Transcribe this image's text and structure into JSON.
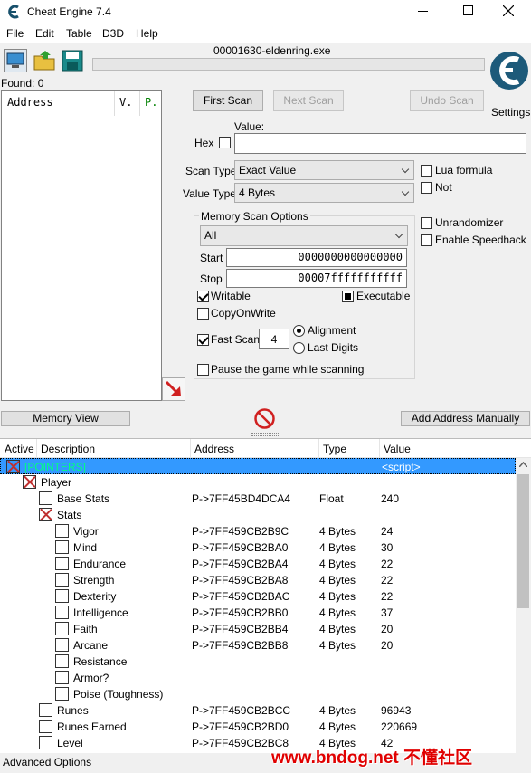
{
  "window": {
    "title": "Cheat Engine 7.4",
    "process": "00001630-eldenring.exe",
    "found": "Found: 0"
  },
  "menu": [
    "File",
    "Edit",
    "Table",
    "D3D",
    "Help"
  ],
  "results_headers": [
    "Address",
    "V.",
    "P."
  ],
  "scan": {
    "first_scan": "First Scan",
    "next_scan": "Next Scan",
    "undo_scan": "Undo Scan",
    "value_label": "Value:",
    "hex_label": "Hex",
    "scan_type_label": "Scan Type",
    "scan_type": "Exact Value",
    "value_type_label": "Value Type",
    "value_type": "4 Bytes",
    "lua_formula": "Lua formula",
    "not": "Not",
    "memory_options_title": "Memory Scan Options",
    "region": "All",
    "start_label": "Start",
    "start_value": "0000000000000000",
    "stop_label": "Stop",
    "stop_value": "00007fffffffffff",
    "writable": "Writable",
    "executable": "Executable",
    "copy_on_write": "CopyOnWrite",
    "fast_scan": "Fast Scan",
    "fast_scan_value": "4",
    "alignment": "Alignment",
    "last_digits": "Last Digits",
    "pause_game": "Pause the game while scanning",
    "unrandomizer": "Unrandomizer",
    "enable_speedhack": "Enable Speedhack",
    "settings": "Settings"
  },
  "bottom": {
    "memory_view": "Memory View",
    "add_address": "Add Address Manually",
    "advanced_options": "Advanced Options"
  },
  "table_headers": [
    "Active",
    "Description",
    "Address",
    "Type",
    "Value"
  ],
  "rows": [
    {
      "indent": 0,
      "box": "x",
      "desc": "[POINTERS]",
      "addr": "",
      "type": "",
      "value": "<script>",
      "selected": true
    },
    {
      "indent": 1,
      "box": "x",
      "desc": "Player",
      "addr": "",
      "type": "",
      "value": ""
    },
    {
      "indent": 2,
      "box": "empty",
      "desc": "Base Stats",
      "addr": "P->7FF45BD4DCA4",
      "type": "Float",
      "value": "240"
    },
    {
      "indent": 2,
      "box": "x",
      "desc": "Stats",
      "addr": "",
      "type": "",
      "value": ""
    },
    {
      "indent": 3,
      "box": "empty",
      "desc": "Vigor",
      "addr": "P->7FF459CB2B9C",
      "type": "4 Bytes",
      "value": "24"
    },
    {
      "indent": 3,
      "box": "empty",
      "desc": "Mind",
      "addr": "P->7FF459CB2BA0",
      "type": "4 Bytes",
      "value": "30"
    },
    {
      "indent": 3,
      "box": "empty",
      "desc": "Endurance",
      "addr": "P->7FF459CB2BA4",
      "type": "4 Bytes",
      "value": "22"
    },
    {
      "indent": 3,
      "box": "empty",
      "desc": "Strength",
      "addr": "P->7FF459CB2BA8",
      "type": "4 Bytes",
      "value": "22"
    },
    {
      "indent": 3,
      "box": "empty",
      "desc": "Dexterity",
      "addr": "P->7FF459CB2BAC",
      "type": "4 Bytes",
      "value": "22"
    },
    {
      "indent": 3,
      "box": "empty",
      "desc": "Intelligence",
      "addr": "P->7FF459CB2BB0",
      "type": "4 Bytes",
      "value": "37"
    },
    {
      "indent": 3,
      "box": "empty",
      "desc": "Faith",
      "addr": "P->7FF459CB2BB4",
      "type": "4 Bytes",
      "value": "20"
    },
    {
      "indent": 3,
      "box": "empty",
      "desc": "Arcane",
      "addr": "P->7FF459CB2BB8",
      "type": "4 Bytes",
      "value": "20"
    },
    {
      "indent": 3,
      "box": "empty",
      "desc": "Resistance",
      "addr": "",
      "type": "",
      "value": ""
    },
    {
      "indent": 3,
      "box": "empty",
      "desc": "Armor?",
      "addr": "",
      "type": "",
      "value": ""
    },
    {
      "indent": 3,
      "box": "empty",
      "desc": "Poise (Toughness)",
      "addr": "",
      "type": "",
      "value": ""
    },
    {
      "indent": 2,
      "box": "empty",
      "desc": "Runes",
      "addr": "P->7FF459CB2BCC",
      "type": "4 Bytes",
      "value": "96943"
    },
    {
      "indent": 2,
      "box": "empty",
      "desc": "Runes Earned",
      "addr": "P->7FF459CB2BD0",
      "type": "4 Bytes",
      "value": "220669"
    },
    {
      "indent": 2,
      "box": "empty",
      "desc": "Level",
      "addr": "P->7FF459CB2BC8",
      "type": "4 Bytes",
      "value": "42"
    }
  ],
  "watermark": "www.bndog.net 不懂社区",
  "colors": {
    "selection": "#3399ff",
    "accent_text": "#00ff80",
    "watermark": "#e00000",
    "arrow": "#d02020"
  }
}
